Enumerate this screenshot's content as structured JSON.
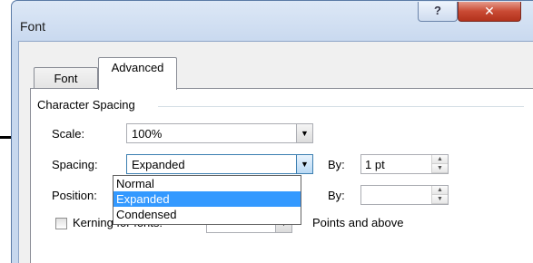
{
  "window": {
    "title": "Font",
    "help_label": "?",
    "close_label": "✕"
  },
  "tabs": [
    {
      "label": "Font",
      "selected": false
    },
    {
      "label": "Advanced",
      "selected": true
    }
  ],
  "character_spacing": {
    "group_label": "Character Spacing",
    "scale": {
      "label": "Scale:",
      "value": "100%"
    },
    "spacing": {
      "label": "Spacing:",
      "value": "Expanded",
      "by_label": "By:",
      "by_value": "1 pt"
    },
    "position": {
      "label": "Position:",
      "by_label": "By:",
      "by_value": ""
    },
    "kerning": {
      "label": "Kerning for fonts:",
      "suffix_label": "Points and above",
      "checked": false
    }
  },
  "spacing_dropdown": {
    "options": [
      "Normal",
      "Expanded",
      "Condensed"
    ],
    "selected": "Expanded"
  },
  "icons": {
    "dropdown": "chevron-down-icon",
    "spin_up": "spin-up-icon",
    "spin_down": "spin-down-icon"
  }
}
